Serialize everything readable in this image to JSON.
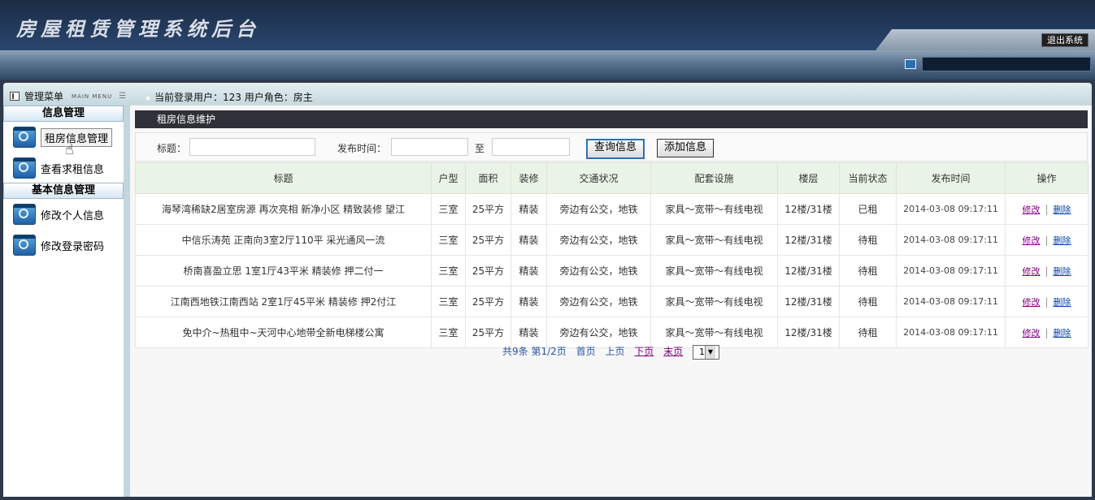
{
  "header": {
    "title": "房屋租赁管理系统后台",
    "logout_label": "退出系统"
  },
  "menu_bar": {
    "title": "管理菜单",
    "subtitle": "MAIN MENU",
    "user_info": "当前登录用户：123 用户角色：房主"
  },
  "sidebar": {
    "groups": [
      {
        "heading": "信息管理",
        "items": [
          {
            "label": "租房信息管理",
            "icon": "gear-icon"
          },
          {
            "label": "查看求租信息",
            "icon": "gear-icon"
          }
        ]
      },
      {
        "heading": "基本信息管理",
        "items": [
          {
            "label": "修改个人信息",
            "icon": "gear-icon"
          },
          {
            "label": "修改登录密码",
            "icon": "gear-icon"
          }
        ]
      }
    ]
  },
  "content": {
    "section_title": "租房信息维护",
    "search": {
      "title_label": "标题：",
      "title_value": "",
      "time_label": "发布时间：",
      "time_from": "",
      "to_label": "至",
      "time_to": "",
      "query_button": "查询信息",
      "add_button": "添加信息"
    },
    "table": {
      "headers": [
        "标题",
        "户型",
        "面积",
        "装修",
        "交通状况",
        "配套设施",
        "楼层",
        "当前状态",
        "发布时间",
        "操作"
      ],
      "rows": [
        [
          "海琴湾稀缺2居室房源 再次亮相 新净小区 精致装修 望江",
          "三室",
          "25平方",
          "精装",
          "旁边有公交，地铁",
          "家具～宽带～有线电视",
          "12楼/31楼",
          "已租",
          "2014-03-08 09:17:11"
        ],
        [
          "中信乐涛苑 正南向3室2厅110平 采光通风一流",
          "三室",
          "25平方",
          "精装",
          "旁边有公交，地铁",
          "家具～宽带～有线电视",
          "12楼/31楼",
          "待租",
          "2014-03-08 09:17:11"
        ],
        [
          "桥南喜盈立思 1室1厅43平米 精装修 押二付一",
          "三室",
          "25平方",
          "精装",
          "旁边有公交，地铁",
          "家具～宽带～有线电视",
          "12楼/31楼",
          "待租",
          "2014-03-08 09:17:11"
        ],
        [
          "江南西地铁江南西站 2室1厅45平米 精装修 押2付江",
          "三室",
          "25平方",
          "精装",
          "旁边有公交，地铁",
          "家具～宽带～有线电视",
          "12楼/31楼",
          "待租",
          "2014-03-08 09:17:11"
        ],
        [
          "免中介~热租中~天河中心地带全新电梯楼公寓",
          "三室",
          "25平方",
          "精装",
          "旁边有公交，地铁",
          "家具～宽带～有线电视",
          "12楼/31楼",
          "待租",
          "2014-03-08 09:17:11"
        ]
      ],
      "edit_label": "修改",
      "delete_label": "删除",
      "op_separator": "|"
    },
    "pager": {
      "summary": "共9条 第1/2页",
      "first": "首页",
      "prev": "上页",
      "next": "下页",
      "last": "末页",
      "page_select": "1"
    }
  }
}
